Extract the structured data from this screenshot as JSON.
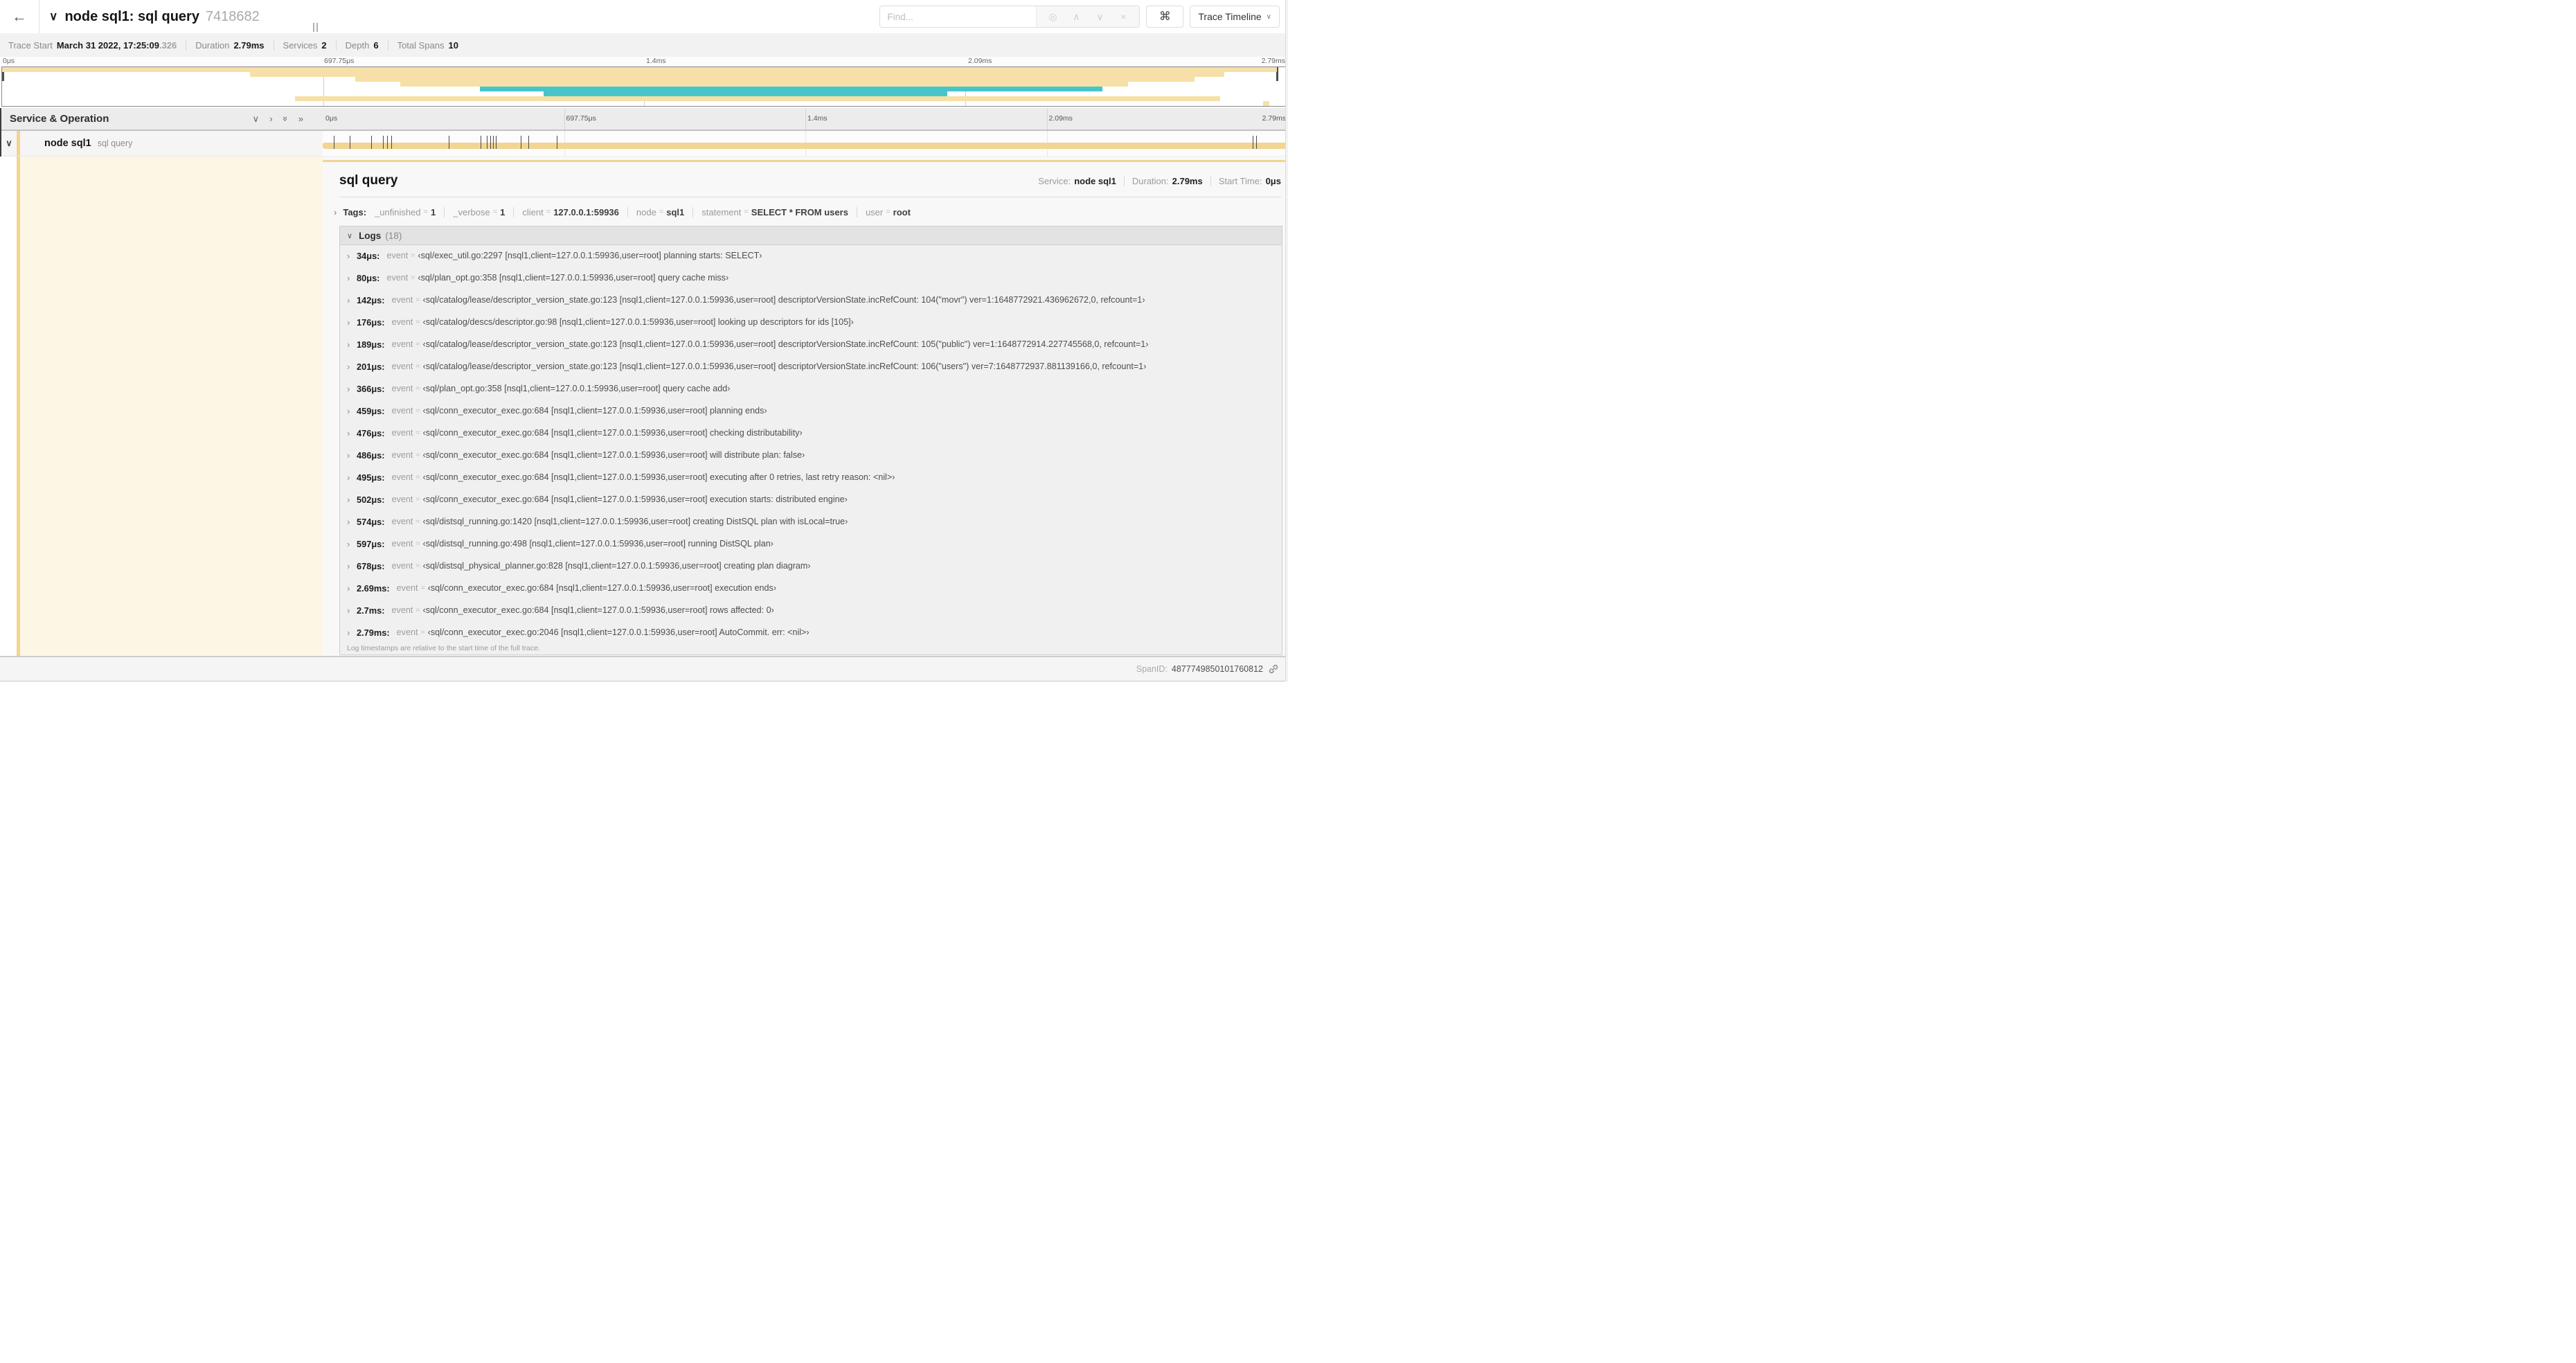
{
  "colors": {
    "tan": "#f2d591",
    "tan_light": "#f6e0a7",
    "teal": "#48c5ca",
    "cream": "#fcf6e4"
  },
  "symbols": {
    "back": "←",
    "chevron_down": "∨",
    "chevron_right": "›",
    "dbl_chevron": "»",
    "locate_icon": "◎",
    "prev_icon": "∧",
    "next_icon": "∨",
    "clear_icon": "×",
    "command_icon": "⌘",
    "eq": "="
  },
  "header": {
    "title": "node sql1: sql query",
    "trace_id_short": "7418682",
    "find_placeholder": "Find...",
    "view_button_label": "Trace Timeline"
  },
  "trace_stats": [
    {
      "label": "Trace Start",
      "value": "March 31 2022, 17:25:09",
      "suffix": ".326"
    },
    {
      "label": "Duration",
      "value": "2.79ms",
      "suffix": ""
    },
    {
      "label": "Services",
      "value": "2",
      "suffix": ""
    },
    {
      "label": "Depth",
      "value": "6",
      "suffix": ""
    },
    {
      "label": "Total Spans",
      "value": "10",
      "suffix": ""
    }
  ],
  "ticks": [
    {
      "label": "0μs"
    },
    {
      "label": "697.75μs"
    },
    {
      "label": "1.4ms"
    },
    {
      "label": "2.09ms"
    },
    {
      "label": "2.79ms"
    }
  ],
  "minimap": {
    "strips": [
      {
        "row": 0,
        "start": 0.0,
        "end": 0.993,
        "color": "tan"
      },
      {
        "row": 1,
        "start": 0.193,
        "end": 0.952,
        "color": "tan"
      },
      {
        "row": 2,
        "start": 0.275,
        "end": 0.929,
        "color": "tan"
      },
      {
        "row": 3,
        "start": 0.31,
        "end": 0.877,
        "color": "tan"
      },
      {
        "row": 4,
        "start": 0.372,
        "end": 0.857,
        "color": "teal"
      },
      {
        "row": 5,
        "start": 0.422,
        "end": 0.736,
        "color": "teal"
      },
      {
        "row": 6,
        "start": 0.228,
        "end": 0.949,
        "color": "tan"
      },
      {
        "row": 7,
        "start": 0.982,
        "end": 0.987,
        "color": "tan"
      }
    ]
  },
  "timeline": {
    "column_header": "Service & Operation"
  },
  "span_row": {
    "service": "node sql1",
    "operation": "sql query",
    "total_us": 2790,
    "log_marker_times_us": [
      34,
      80,
      142,
      176,
      189,
      201,
      366,
      459,
      476,
      486,
      495,
      502,
      574,
      597,
      678,
      2690,
      2700,
      2790
    ]
  },
  "detail": {
    "title": "sql query",
    "meta": [
      {
        "label": "Service:",
        "value": "node sql1"
      },
      {
        "label": "Duration:",
        "value": "2.79ms"
      },
      {
        "label": "Start Time:",
        "value": "0μs"
      }
    ],
    "tags_label": "Tags:",
    "tags": [
      {
        "key": "_unfinished",
        "value": "1"
      },
      {
        "key": "_verbose",
        "value": "1"
      },
      {
        "key": "client",
        "value": "127.0.0.1:59936"
      },
      {
        "key": "node",
        "value": "sql1"
      },
      {
        "key": "statement",
        "value": "SELECT * FROM users"
      },
      {
        "key": "user",
        "value": "root"
      }
    ],
    "logs_label": "Logs",
    "logs_count": "(18)",
    "logs": [
      {
        "time": "34μs:",
        "key": "event",
        "value": "‹sql/exec_util.go:2297 [nsql1,client=127.0.0.1:59936,user=root] planning starts: SELECT›"
      },
      {
        "time": "80μs:",
        "key": "event",
        "value": "‹sql/plan_opt.go:358 [nsql1,client=127.0.0.1:59936,user=root] query cache miss›"
      },
      {
        "time": "142μs:",
        "key": "event",
        "value": "‹sql/catalog/lease/descriptor_version_state.go:123 [nsql1,client=127.0.0.1:59936,user=root] descriptorVersionState.incRefCount: 104(\"movr\") ver=1:1648772921.436962672,0, refcount=1›"
      },
      {
        "time": "176μs:",
        "key": "event",
        "value": "‹sql/catalog/descs/descriptor.go:98 [nsql1,client=127.0.0.1:59936,user=root] looking up descriptors for ids [105]›"
      },
      {
        "time": "189μs:",
        "key": "event",
        "value": "‹sql/catalog/lease/descriptor_version_state.go:123 [nsql1,client=127.0.0.1:59936,user=root] descriptorVersionState.incRefCount: 105(\"public\") ver=1:1648772914.227745568,0, refcount=1›"
      },
      {
        "time": "201μs:",
        "key": "event",
        "value": "‹sql/catalog/lease/descriptor_version_state.go:123 [nsql1,client=127.0.0.1:59936,user=root] descriptorVersionState.incRefCount: 106(\"users\") ver=7:1648772937.881139166,0, refcount=1›"
      },
      {
        "time": "366μs:",
        "key": "event",
        "value": "‹sql/plan_opt.go:358 [nsql1,client=127.0.0.1:59936,user=root] query cache add›"
      },
      {
        "time": "459μs:",
        "key": "event",
        "value": "‹sql/conn_executor_exec.go:684 [nsql1,client=127.0.0.1:59936,user=root] planning ends›"
      },
      {
        "time": "476μs:",
        "key": "event",
        "value": "‹sql/conn_executor_exec.go:684 [nsql1,client=127.0.0.1:59936,user=root] checking distributability›"
      },
      {
        "time": "486μs:",
        "key": "event",
        "value": "‹sql/conn_executor_exec.go:684 [nsql1,client=127.0.0.1:59936,user=root] will distribute plan: false›"
      },
      {
        "time": "495μs:",
        "key": "event",
        "value": "‹sql/conn_executor_exec.go:684 [nsql1,client=127.0.0.1:59936,user=root] executing after 0 retries, last retry reason: <nil>›"
      },
      {
        "time": "502μs:",
        "key": "event",
        "value": "‹sql/conn_executor_exec.go:684 [nsql1,client=127.0.0.1:59936,user=root] execution starts: distributed engine›"
      },
      {
        "time": "574μs:",
        "key": "event",
        "value": "‹sql/distsql_running.go:1420 [nsql1,client=127.0.0.1:59936,user=root] creating DistSQL plan with isLocal=true›"
      },
      {
        "time": "597μs:",
        "key": "event",
        "value": "‹sql/distsql_running.go:498 [nsql1,client=127.0.0.1:59936,user=root] running DistSQL plan›"
      },
      {
        "time": "678μs:",
        "key": "event",
        "value": "‹sql/distsql_physical_planner.go:828 [nsql1,client=127.0.0.1:59936,user=root] creating plan diagram›"
      },
      {
        "time": "2.69ms:",
        "key": "event",
        "value": "‹sql/conn_executor_exec.go:684 [nsql1,client=127.0.0.1:59936,user=root] execution ends›"
      },
      {
        "time": "2.7ms:",
        "key": "event",
        "value": "‹sql/conn_executor_exec.go:684 [nsql1,client=127.0.0.1:59936,user=root] rows affected: 0›"
      },
      {
        "time": "2.79ms:",
        "key": "event",
        "value": "‹sql/conn_executor_exec.go:2046 [nsql1,client=127.0.0.1:59936,user=root] AutoCommit. err: <nil>›"
      }
    ],
    "logs_note": "Log timestamps are relative to the start time of the full trace.",
    "span_id_label": "SpanID:",
    "span_id": "4877749850101760812"
  }
}
